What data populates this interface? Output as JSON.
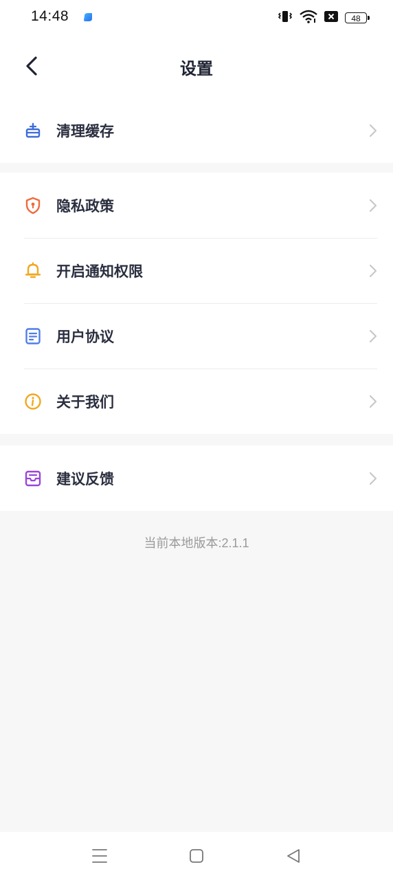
{
  "status_bar": {
    "time": "14:48",
    "battery": "48",
    "icons": [
      "app-notification-icon",
      "vibrate-icon",
      "wifi-icon",
      "no-sim-icon",
      "battery-icon"
    ]
  },
  "header": {
    "title": "设置",
    "back_icon": "back-arrow-icon"
  },
  "groups": [
    {
      "items": [
        {
          "label": "清理缓存",
          "icon": "broom-icon",
          "color": "#3d6bd9"
        }
      ]
    },
    {
      "items": [
        {
          "label": "隐私政策",
          "icon": "shield-icon",
          "color": "#ee6b3b"
        },
        {
          "label": "开启通知权限",
          "icon": "bell-icon",
          "color": "#f0a821"
        },
        {
          "label": "用户协议",
          "icon": "document-icon",
          "color": "#4e7ee6"
        },
        {
          "label": "关于我们",
          "icon": "info-icon",
          "color": "#f0a821"
        }
      ]
    },
    {
      "items": [
        {
          "label": "建议反馈",
          "icon": "inbox-icon",
          "color": "#9a44d8"
        }
      ]
    }
  ],
  "footer": {
    "version_text": "当前本地版本:2.1.1"
  },
  "nav_bar": {
    "buttons": [
      "menu-icon",
      "home-icon",
      "back-triangle-icon"
    ]
  },
  "colors": {
    "background": "#f7f7f7",
    "surface": "#ffffff",
    "chevron": "#c8c8c8",
    "divider": "#ececec"
  }
}
